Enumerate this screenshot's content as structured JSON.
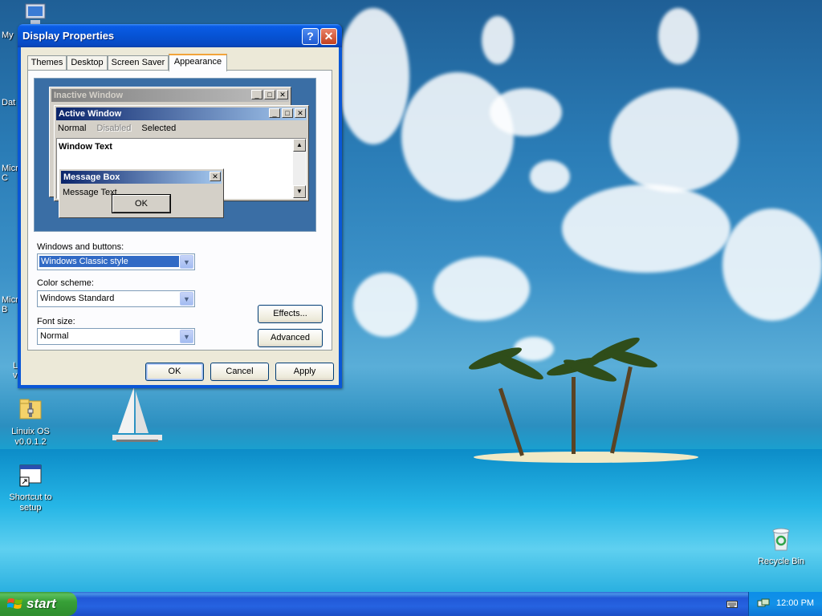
{
  "desktop": {
    "icons": [
      {
        "label": "My"
      },
      {
        "label": "Dat"
      },
      {
        "label": "Micr\nC"
      },
      {
        "label": "Micr\nB"
      },
      {
        "label": "L\nv"
      },
      {
        "label": "Linuix OS\nv0.0.1.2"
      },
      {
        "label": "Shortcut to\nsetup"
      },
      {
        "label": "Recycle Bin"
      }
    ]
  },
  "window": {
    "title": "Display Properties",
    "help_glyph": "?",
    "close_glyph": "✕",
    "tabs": [
      {
        "label": "Themes"
      },
      {
        "label": "Desktop"
      },
      {
        "label": "Screen Saver"
      },
      {
        "label": "Appearance"
      }
    ],
    "preview": {
      "inactive_title": "Inactive Window",
      "active_title": "Active Window",
      "menu_normal": "Normal",
      "menu_disabled": "Disabled",
      "menu_selected": "Selected",
      "window_text": "Window Text",
      "msgbox_title": "Message Box",
      "msgbox_text": "Message Text",
      "msgbox_ok": "OK"
    },
    "fields": {
      "windows_buttons_label": "Windows and buttons:",
      "windows_buttons_value": "Windows Classic style",
      "color_scheme_label": "Color scheme:",
      "color_scheme_value": "Windows Standard",
      "font_size_label": "Font size:",
      "font_size_value": "Normal"
    },
    "buttons": {
      "effects": "Effects...",
      "advanced": "Advanced",
      "ok": "OK",
      "cancel": "Cancel",
      "apply": "Apply"
    }
  },
  "taskbar": {
    "start_label": "start",
    "clock": "12:00 PM"
  },
  "colors": {
    "title_blue": "#0a5ce6",
    "start_green": "#37a037",
    "dialog_bg": "#ece9d8",
    "accent_tab": "#f2a43a"
  }
}
